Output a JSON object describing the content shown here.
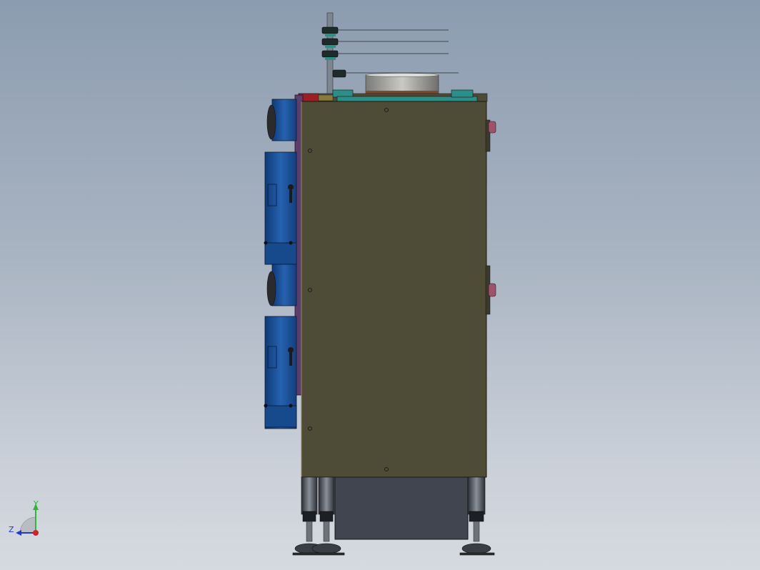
{
  "viewport": {
    "background_top": "#8c9cb0",
    "background_bottom": "#d6dae0"
  },
  "model": {
    "main_panel_color": "#4e4c36",
    "side_plate_color": "#5e3f6c",
    "motor_color": "#1c4f95",
    "base_box_color": "#41454f",
    "top_plate_color": "#2c8f87"
  },
  "triad": {
    "y_label": "Y",
    "z_label": "Z",
    "y_color": "#2fb53a",
    "z_color": "#2536d6",
    "x_color": "#d42020"
  }
}
